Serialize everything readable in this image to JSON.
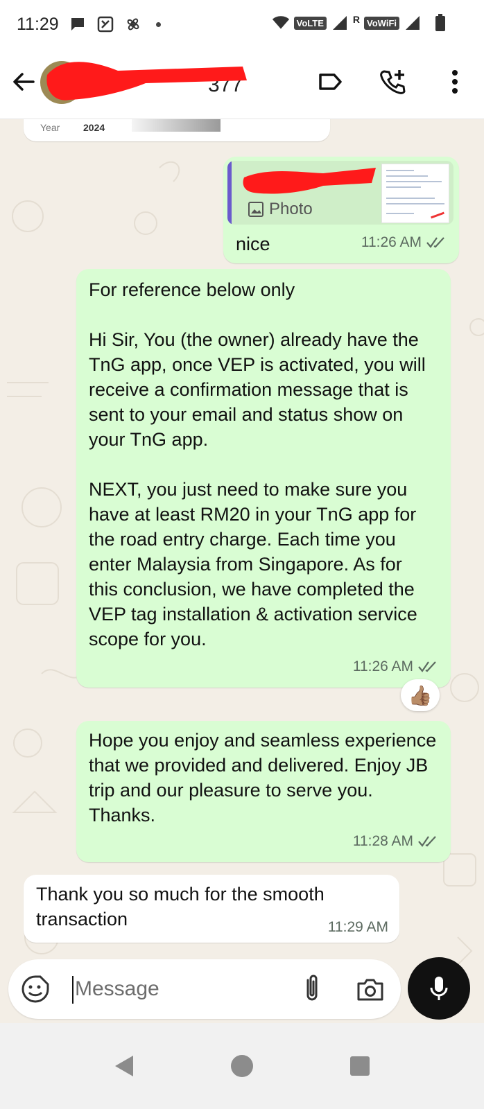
{
  "status_bar": {
    "time": "11:29",
    "volte": "VoLTE",
    "roaming": "R",
    "vowifi": "VoWiFi"
  },
  "header": {
    "contact_name_partial": "377"
  },
  "previous_card": {
    "label": "Year",
    "value": "2024"
  },
  "messages": [
    {
      "direction": "outgoing",
      "quote_label": "Photo",
      "text": "nice",
      "time": "11:26 AM",
      "status": "read"
    },
    {
      "direction": "outgoing",
      "paragraphs": [
        "For reference below only",
        "Hi Sir, You (the owner) already have the TnG  app, once VEP is activated, you will receive a confirmation message that is sent to your email and status show on your TnG app.",
        "NEXT, you just need to make sure you have at least RM20 in your TnG app for the road entry charge. Each time you enter Malaysia from Singapore. As for this conclusion, we have completed the VEP tag installation & activation service scope for you."
      ],
      "time": "11:26 AM",
      "status": "read",
      "reaction": "👍🏽"
    },
    {
      "direction": "outgoing",
      "text": "Hope you enjoy and seamless experience that we provided and delivered. Enjoy JB trip and our pleasure to serve you. Thanks.",
      "time": "11:28 AM",
      "status": "read"
    },
    {
      "direction": "incoming",
      "text": "Thank you so much for the smooth transaction",
      "time": "11:29 AM"
    }
  ],
  "composer": {
    "placeholder": "Message"
  },
  "colors": {
    "outgoing_bubble": "#d9fdd3",
    "incoming_bubble": "#ffffff",
    "chat_background": "#f3eee6",
    "mic_button": "#111111",
    "read_ticks": "#5c6a60"
  },
  "icons": {
    "back": "arrow-left-icon",
    "label": "label-icon",
    "add_call": "add-call-icon",
    "more": "more-vertical-icon",
    "emoji": "sticker-icon",
    "attach": "paperclip-icon",
    "camera": "camera-icon",
    "mic": "mic-icon"
  }
}
